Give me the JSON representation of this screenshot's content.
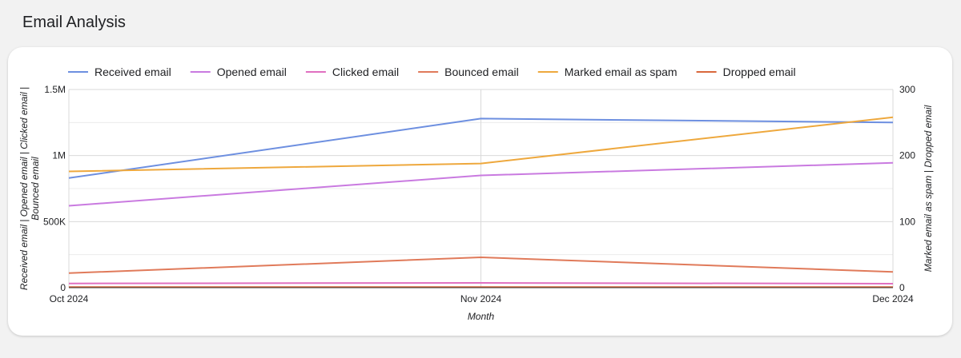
{
  "page": {
    "title": "Email Analysis"
  },
  "chart_data": {
    "type": "line",
    "title": "",
    "x": [
      "Oct 2024",
      "Nov 2024",
      "Dec 2024"
    ],
    "xlabel": "Month",
    "ylabel_left": "Received email | Opened email | Clicked email | Bounced email",
    "ylabel_right": "Marked email as spam | Dropped email",
    "y_left": {
      "min": 0,
      "max": 1500000,
      "ticks": [
        0,
        500000,
        1000000,
        1500000
      ],
      "tick_labels": [
        "0",
        "500K",
        "1M",
        "1.5M"
      ]
    },
    "y_right": {
      "min": 0,
      "max": 300,
      "ticks": [
        0,
        100,
        200,
        300
      ],
      "tick_labels": [
        "0",
        "100",
        "200",
        "300"
      ]
    },
    "grid": true,
    "legend_position": "top",
    "series": [
      {
        "name": "Received email",
        "axis": "left",
        "color": "#6d8fe0",
        "values": [
          830000,
          1280000,
          1250000
        ]
      },
      {
        "name": "Opened email",
        "axis": "left",
        "color": "#c97ae0",
        "values": [
          620000,
          850000,
          945000
        ]
      },
      {
        "name": "Clicked email",
        "axis": "left",
        "color": "#e06fc0",
        "values": [
          32000,
          36000,
          30000
        ]
      },
      {
        "name": "Bounced email",
        "axis": "left",
        "color": "#e07a5a",
        "values": [
          110000,
          230000,
          120000
        ]
      },
      {
        "name": "Marked email as spam",
        "axis": "right",
        "color": "#eea83d",
        "values": [
          176,
          188,
          258
        ]
      },
      {
        "name": "Dropped email",
        "axis": "right",
        "color": "#d9673c",
        "values": [
          1,
          1,
          1
        ]
      }
    ]
  }
}
